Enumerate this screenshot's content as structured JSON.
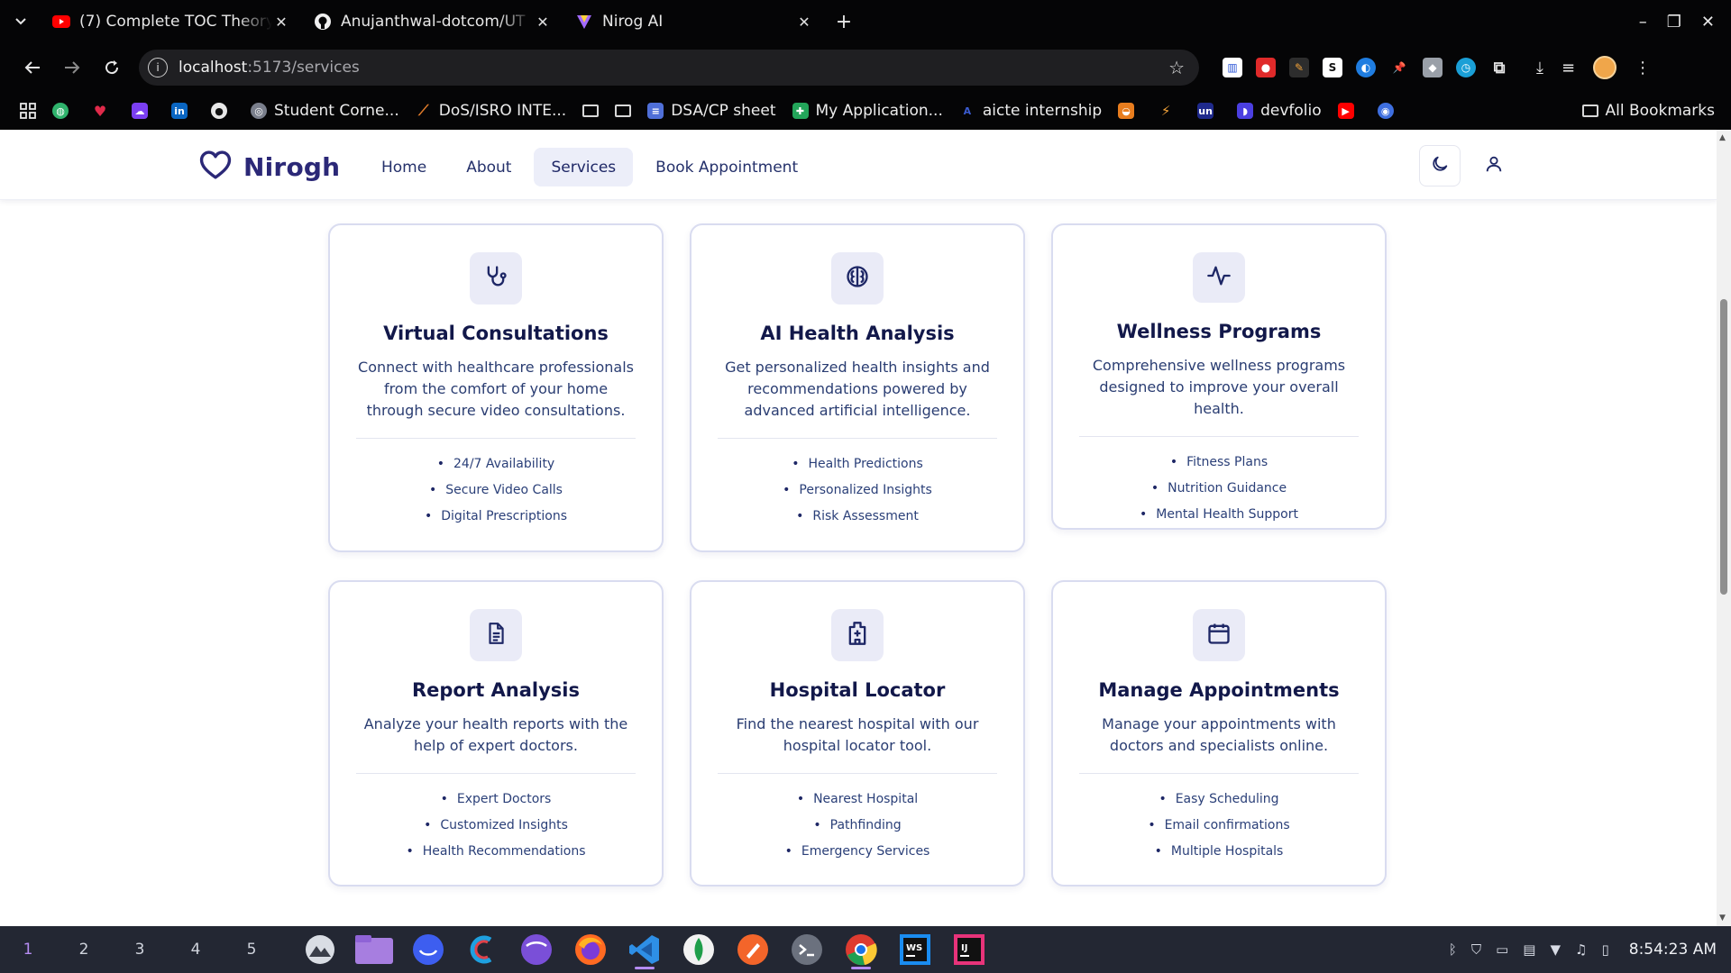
{
  "browser": {
    "tabs": [
      {
        "title": "(7) Complete TOC Theory",
        "favicon": "youtube-icon",
        "active": false
      },
      {
        "title": "Anujanthwal-dotcom/UT",
        "favicon": "github-icon",
        "active": false
      },
      {
        "title": "Nirog AI",
        "favicon": "nirog-icon",
        "active": true
      }
    ],
    "url_host": "localhost",
    "url_path": ":5173/services",
    "bookmarks": [
      {
        "label": "Student Corne...",
        "color": "#7a7f8c"
      },
      {
        "label": "DoS/ISRO INTE...",
        "color": "#e07b2a"
      },
      {
        "label": "",
        "color": "folder"
      },
      {
        "label": "DSA/CP sheet",
        "color": "#4f6fd8"
      },
      {
        "label": "My Application...",
        "color": "#23a55a"
      },
      {
        "label": "aicte internship",
        "color": "#3a5bd0"
      },
      {
        "label": "devfolio",
        "color": "#4b3fe0"
      }
    ],
    "all_bookmarks_label": "All Bookmarks"
  },
  "site": {
    "brand": "Nirogh",
    "nav": [
      {
        "label": "Home",
        "active": false
      },
      {
        "label": "About",
        "active": false
      },
      {
        "label": "Services",
        "active": true
      },
      {
        "label": "Book Appointment",
        "active": false
      }
    ],
    "accent": "#2b2877"
  },
  "services": [
    {
      "icon": "stethoscope-icon",
      "title": "Virtual Consultations",
      "description": "Connect with healthcare professionals from the comfort of your home through secure video consultations.",
      "features": [
        "24/7 Availability",
        "Secure Video Calls",
        "Digital Prescriptions"
      ]
    },
    {
      "icon": "brain-icon",
      "title": "AI Health Analysis",
      "description": "Get personalized health insights and recommendations powered by advanced artificial intelligence.",
      "features": [
        "Health Predictions",
        "Personalized Insights",
        "Risk Assessment"
      ]
    },
    {
      "icon": "activity-icon",
      "title": "Wellness Programs",
      "description": "Comprehensive wellness programs designed to improve your overall health.",
      "features": [
        "Fitness Plans",
        "Nutrition Guidance",
        "Mental Health Support"
      ]
    },
    {
      "icon": "document-icon",
      "title": "Report Analysis",
      "description": "Analyze your health reports with the help of expert doctors.",
      "features": [
        "Expert Doctors",
        "Customized Insights",
        "Health Recommendations"
      ]
    },
    {
      "icon": "hospital-icon",
      "title": "Hospital Locator",
      "description": "Find the nearest hospital with our hospital locator tool.",
      "features": [
        "Nearest Hospital",
        "Pathfinding",
        "Emergency Services"
      ]
    },
    {
      "icon": "calendar-icon",
      "title": "Manage Appointments",
      "description": "Manage your appointments with doctors and specialists online.",
      "features": [
        "Easy Scheduling",
        "Email confirmations",
        "Multiple Hospitals"
      ]
    }
  ],
  "taskbar": {
    "workspaces": [
      "1",
      "2",
      "3",
      "4",
      "5"
    ],
    "active_workspace": "1",
    "clock": "8:54:23 AM"
  }
}
